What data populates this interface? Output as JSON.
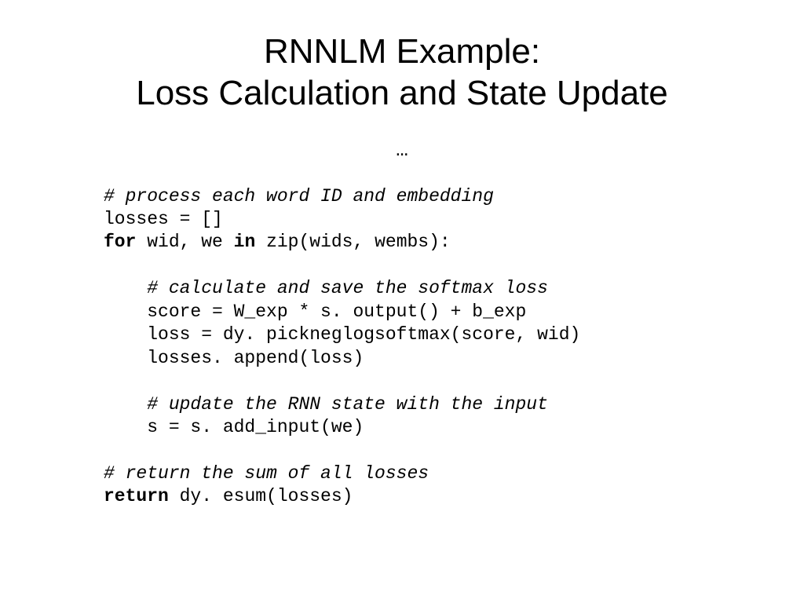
{
  "title": {
    "line1": "RNNLM Example:",
    "line2": "Loss Calculation and State Update"
  },
  "ellipsis": "…",
  "code": {
    "comment1": "# process each word ID and embedding",
    "line2": "losses = []",
    "line3_kw1": "for",
    "line3_mid": " wid, we ",
    "line3_kw2": "in",
    "line3_end": " zip(wids, wembs):",
    "comment2": "    # calculate and save the softmax loss",
    "line5": "    score = W_exp * s. output() + b_exp",
    "line6": "    loss = dy. pickneglogsoftmax(score, wid)",
    "line7": "    losses. append(loss)",
    "comment3": "    # update the RNN state with the input",
    "line9": "    s = s. add_input(we)",
    "comment4": "# return the sum of all losses",
    "line11_kw": "return",
    "line11_end": " dy. esum(losses)"
  }
}
